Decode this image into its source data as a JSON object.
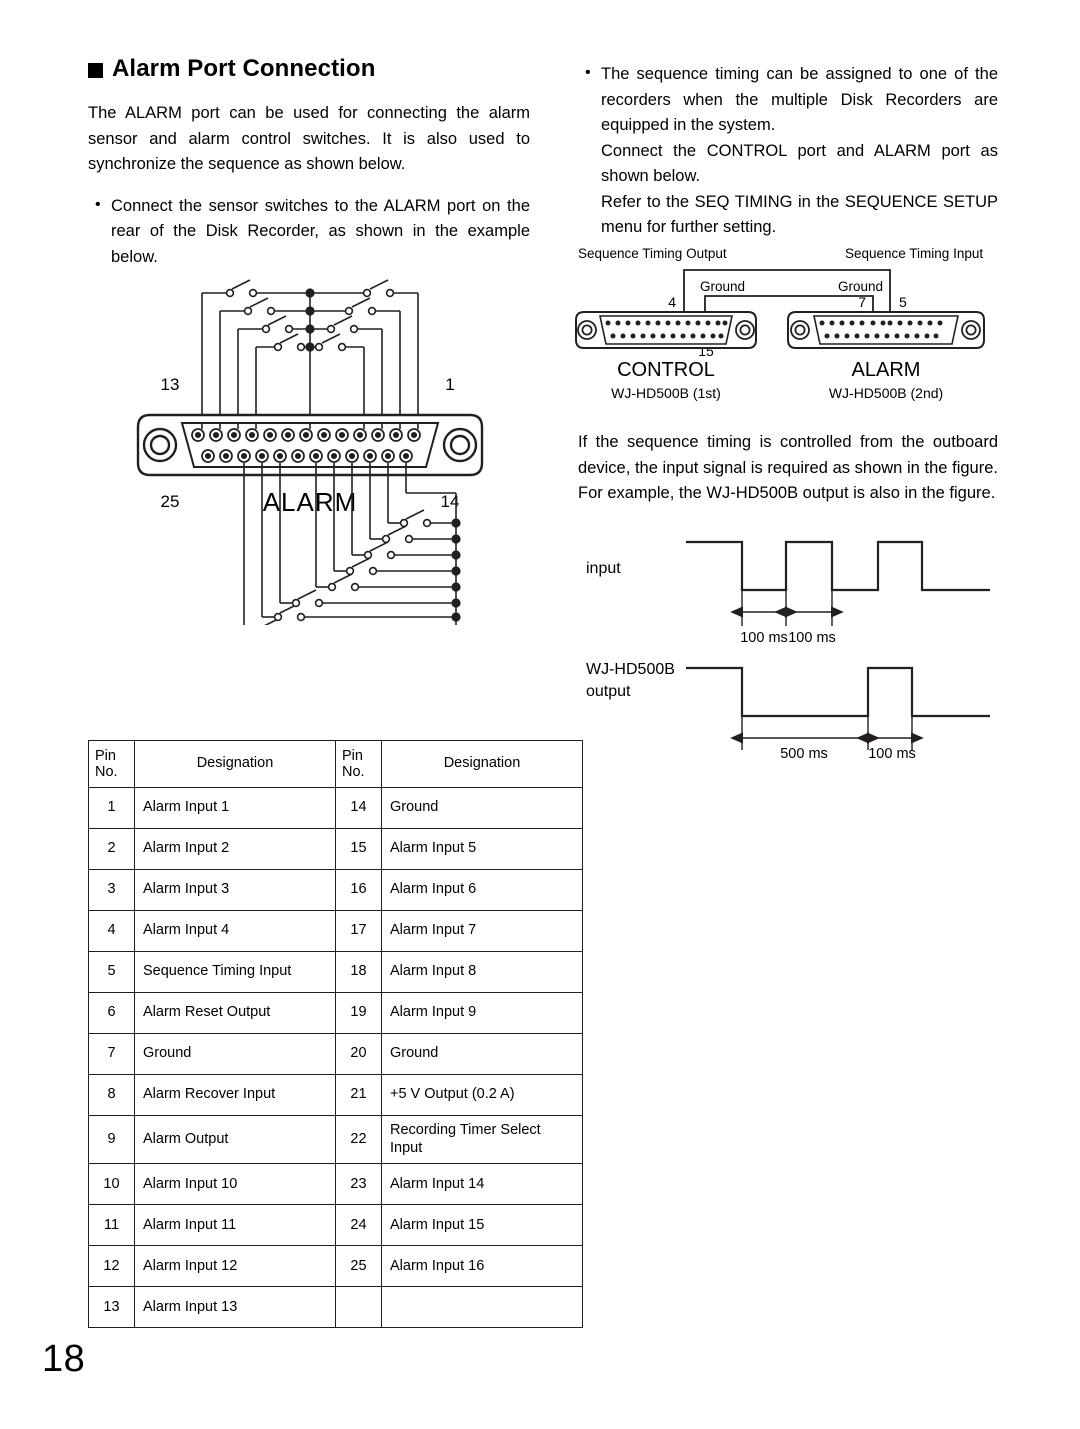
{
  "page": {
    "number": "18"
  },
  "heading": {
    "bullet_icon": "filled-square",
    "title": "Alarm Port Connection"
  },
  "left_column": {
    "intro": "The ALARM port can be used for connecting the alarm sensor and alarm control switches. It is also used to synchronize the sequence as shown below.",
    "bullets": [
      "Connect the sensor switches to the ALARM port on the rear of the Disk Recorder, as shown in the example below."
    ]
  },
  "right_column": {
    "bullets": [
      {
        "lines": [
          "The sequence timing can be assigned to one of the recorders when the multiple Disk Recorders are equipped in the system.",
          "Connect the CONTROL port and ALARM port as shown below.",
          "Refer to the SEQ TIMING in the SEQUENCE SETUP menu for further setting."
        ]
      }
    ],
    "paragraph": "If the sequence timing is controlled from the outboard device, the input signal is required as shown in the figure. For example, the WJ-HD500B output is also in the figure."
  },
  "alarm_figure": {
    "connector_label": "ALARM",
    "pin_labels": {
      "top_left": "13",
      "top_right": "1",
      "bottom_left": "25",
      "bottom_right": "14"
    },
    "top_row_pins": 13,
    "bottom_row_pins": 12,
    "upper_switch_rows": 4,
    "lower_switch_rows": 8
  },
  "ports_figure": {
    "left_connector": {
      "top_caption": "Sequence Timing Output",
      "ground_label": "Ground",
      "pin_top": "4",
      "pin_bottom": "15",
      "name": "CONTROL",
      "model": "WJ-HD500B (1st)"
    },
    "right_connector": {
      "top_caption": "Sequence Timing Input",
      "ground_label": "Ground",
      "pin_ground": "7",
      "pin_signal": "5",
      "name": "ALARM",
      "model": "WJ-HD500B (2nd)"
    }
  },
  "timing_figure": {
    "signals": [
      {
        "label": "input",
        "label_lines": [
          "input"
        ],
        "measurements": [
          "100 ms",
          "100 ms"
        ]
      },
      {
        "label": "WJ-HD500B output",
        "label_lines": [
          "WJ-HD500B",
          "output"
        ],
        "measurements": [
          "500 ms",
          "100 ms"
        ]
      }
    ]
  },
  "pin_table": {
    "headers": {
      "pin_line1": "Pin",
      "pin_line2": "No.",
      "designation": "Designation"
    },
    "rows": [
      {
        "pin_a": "1",
        "des_a": "Alarm Input 1",
        "pin_b": "14",
        "des_b": "Ground"
      },
      {
        "pin_a": "2",
        "des_a": "Alarm Input 2",
        "pin_b": "15",
        "des_b": "Alarm Input 5"
      },
      {
        "pin_a": "3",
        "des_a": "Alarm Input 3",
        "pin_b": "16",
        "des_b": "Alarm Input 6"
      },
      {
        "pin_a": "4",
        "des_a": "Alarm Input 4",
        "pin_b": "17",
        "des_b": "Alarm Input 7"
      },
      {
        "pin_a": "5",
        "des_a": "Sequence Timing Input",
        "pin_b": "18",
        "des_b": "Alarm Input 8"
      },
      {
        "pin_a": "6",
        "des_a": "Alarm Reset Output",
        "pin_b": "19",
        "des_b": "Alarm Input 9"
      },
      {
        "pin_a": "7",
        "des_a": "Ground",
        "pin_b": "20",
        "des_b": "Ground"
      },
      {
        "pin_a": "8",
        "des_a": "Alarm Recover Input",
        "pin_b": "21",
        "des_b": "+5 V Output (0.2 A)"
      },
      {
        "pin_a": "9",
        "des_a": "Alarm Output",
        "pin_b": "22",
        "des_b": "Recording Timer Select Input"
      },
      {
        "pin_a": "10",
        "des_a": "Alarm Input 10",
        "pin_b": "23",
        "des_b": "Alarm Input 14"
      },
      {
        "pin_a": "11",
        "des_a": "Alarm Input 11",
        "pin_b": "24",
        "des_b": "Alarm Input 15"
      },
      {
        "pin_a": "12",
        "des_a": "Alarm Input 12",
        "pin_b": "25",
        "des_b": "Alarm Input 16"
      },
      {
        "pin_a": "13",
        "des_a": "Alarm Input 13",
        "pin_b": "",
        "des_b": ""
      }
    ]
  }
}
